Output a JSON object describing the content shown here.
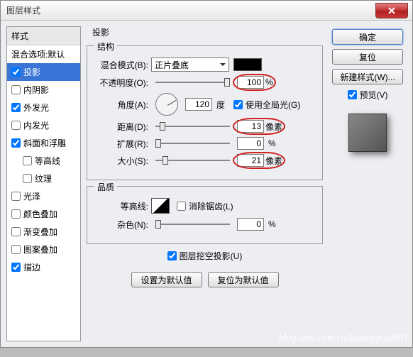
{
  "window": {
    "title": "图层样式"
  },
  "sidebar": {
    "header": "样式",
    "blending": "混合选项:默认",
    "items": [
      {
        "label": "投影",
        "checked": true,
        "selected": true
      },
      {
        "label": "内阴影",
        "checked": false
      },
      {
        "label": "外发光",
        "checked": true
      },
      {
        "label": "内发光",
        "checked": false
      },
      {
        "label": "斜面和浮雕",
        "checked": true
      },
      {
        "label": "等高线",
        "checked": false,
        "sub": true
      },
      {
        "label": "纹理",
        "checked": false,
        "sub": true
      },
      {
        "label": "光泽",
        "checked": false
      },
      {
        "label": "颜色叠加",
        "checked": false
      },
      {
        "label": "渐变叠加",
        "checked": false
      },
      {
        "label": "图案叠加",
        "checked": false
      },
      {
        "label": "描边",
        "checked": true
      }
    ]
  },
  "main_title": "投影",
  "structure": {
    "title": "结构",
    "blend_mode_label": "混合模式(B):",
    "blend_mode_value": "正片叠底",
    "opacity_label": "不透明度(O):",
    "opacity_value": "100",
    "percent": "%",
    "angle_label": "角度(A):",
    "angle_value": "120",
    "degree": "度",
    "global_light": "使用全局光(G)",
    "distance_label": "距离(D):",
    "distance_value": "13",
    "px": "像素",
    "spread_label": "扩展(R):",
    "spread_value": "0",
    "size_label": "大小(S):",
    "size_value": "21"
  },
  "quality": {
    "title": "品质",
    "contour_label": "等高线:",
    "antialias": "消除锯齿(L)",
    "noise_label": "杂色(N):",
    "noise_value": "0",
    "percent": "%"
  },
  "knockout": "图层挖空投影(U)",
  "buttons": {
    "set_default": "设置为默认值",
    "reset_default": "复位为默认值",
    "ok": "确定",
    "cancel": "复位",
    "new_style": "新建样式(W)...",
    "preview": "预览(V)"
  },
  "watermark": "blog.sina.com.cn/blueapple2001"
}
